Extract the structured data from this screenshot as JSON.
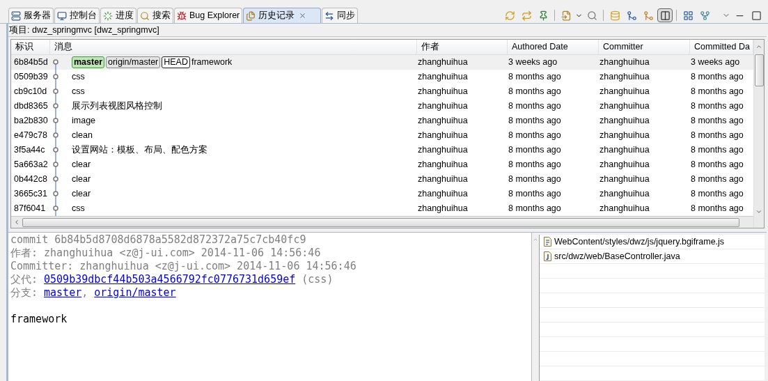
{
  "tabs": [
    {
      "label": "服务器",
      "selected": false
    },
    {
      "label": "控制台",
      "selected": false
    },
    {
      "label": "进度",
      "selected": false
    },
    {
      "label": "搜索",
      "selected": false
    },
    {
      "label": "Bug Explorer",
      "selected": false
    },
    {
      "label": "历史记录",
      "selected": true
    },
    {
      "label": "同步",
      "selected": false
    }
  ],
  "project_label": "项目: dwz_springmvc [dwz_springmvc]",
  "table": {
    "columns": [
      "标识",
      "消息",
      "作者",
      "Authored Date",
      "Committer",
      "Committed Da"
    ],
    "rows": [
      {
        "id": "6b84b5d",
        "refs": [
          {
            "label": "master",
            "kind": "local"
          },
          {
            "label": "origin/master",
            "kind": "remote"
          },
          {
            "label": "HEAD",
            "kind": "head"
          }
        ],
        "message": "framework",
        "author": "zhanghuihua",
        "authored": "3 weeks ago",
        "committer": "zhanghuihua",
        "committed": "3 weeks ago",
        "selected": true
      },
      {
        "id": "0509b39",
        "message": "css",
        "author": "zhanghuihua",
        "authored": "8 months ago",
        "committer": "zhanghuihua",
        "committed": "8 months ago",
        "selected": false
      },
      {
        "id": "cb9c10d",
        "message": "css",
        "author": "zhanghuihua",
        "authored": "8 months ago",
        "committer": "zhanghuihua",
        "committed": "8 months ago",
        "selected": false
      },
      {
        "id": "dbd8365",
        "message": "展示列表视图风格控制",
        "author": "zhanghuihua",
        "authored": "8 months ago",
        "committer": "zhanghuihua",
        "committed": "8 months ago",
        "selected": false
      },
      {
        "id": "ba2b830",
        "message": "image",
        "author": "zhanghuihua",
        "authored": "8 months ago",
        "committer": "zhanghuihua",
        "committed": "8 months ago",
        "selected": false
      },
      {
        "id": "e479c78",
        "message": "clean",
        "author": "zhanghuihua",
        "authored": "8 months ago",
        "committer": "zhanghuihua",
        "committed": "8 months ago",
        "selected": false
      },
      {
        "id": "3f5a44c",
        "message": "设置网站：模板、布局、配色方案",
        "author": "zhanghuihua",
        "authored": "8 months ago",
        "committer": "zhanghuihua",
        "committed": "8 months ago",
        "selected": false
      },
      {
        "id": "5a663a2",
        "message": "clear",
        "author": "zhanghuihua",
        "authored": "8 months ago",
        "committer": "zhanghuihua",
        "committed": "8 months ago",
        "selected": false
      },
      {
        "id": "0b442c8",
        "message": "clear",
        "author": "zhanghuihua",
        "authored": "8 months ago",
        "committer": "zhanghuihua",
        "committed": "8 months ago",
        "selected": false
      },
      {
        "id": "3665c31",
        "message": "clear",
        "author": "zhanghuihua",
        "authored": "8 months ago",
        "committer": "zhanghuihua",
        "committed": "8 months ago",
        "selected": false
      },
      {
        "id": "87f6041",
        "message": "css",
        "author": "zhanghuihua",
        "authored": "8 months ago",
        "committer": "zhanghuihua",
        "committed": "8 months ago",
        "selected": false
      }
    ]
  },
  "detail": {
    "commit_line": "commit 6b84b5d8708d6878a5582d872372a75c7cb40fc9",
    "author_line": "作者: zhanghuihua <z@j-ui.com> 2014-11-06 14:56:46",
    "committer_line": "Committer: zhanghuihua <z@j-ui.com> 2014-11-06 14:56:46",
    "parent": {
      "label": "父代:",
      "link": "0509b39dbcf44b503a4566792fc0776731d659ef",
      "suffix": "(css)"
    },
    "branches": {
      "label": "分支:",
      "separator": ",",
      "links": [
        "master",
        "origin/master"
      ]
    },
    "message": "framework"
  },
  "files": [
    {
      "path": "WebContent/styles/dwz/js/jquery.bgiframe.js",
      "kind": "js"
    },
    {
      "path": "src/dwz/web/BaseController.java",
      "kind": "java"
    }
  ]
}
